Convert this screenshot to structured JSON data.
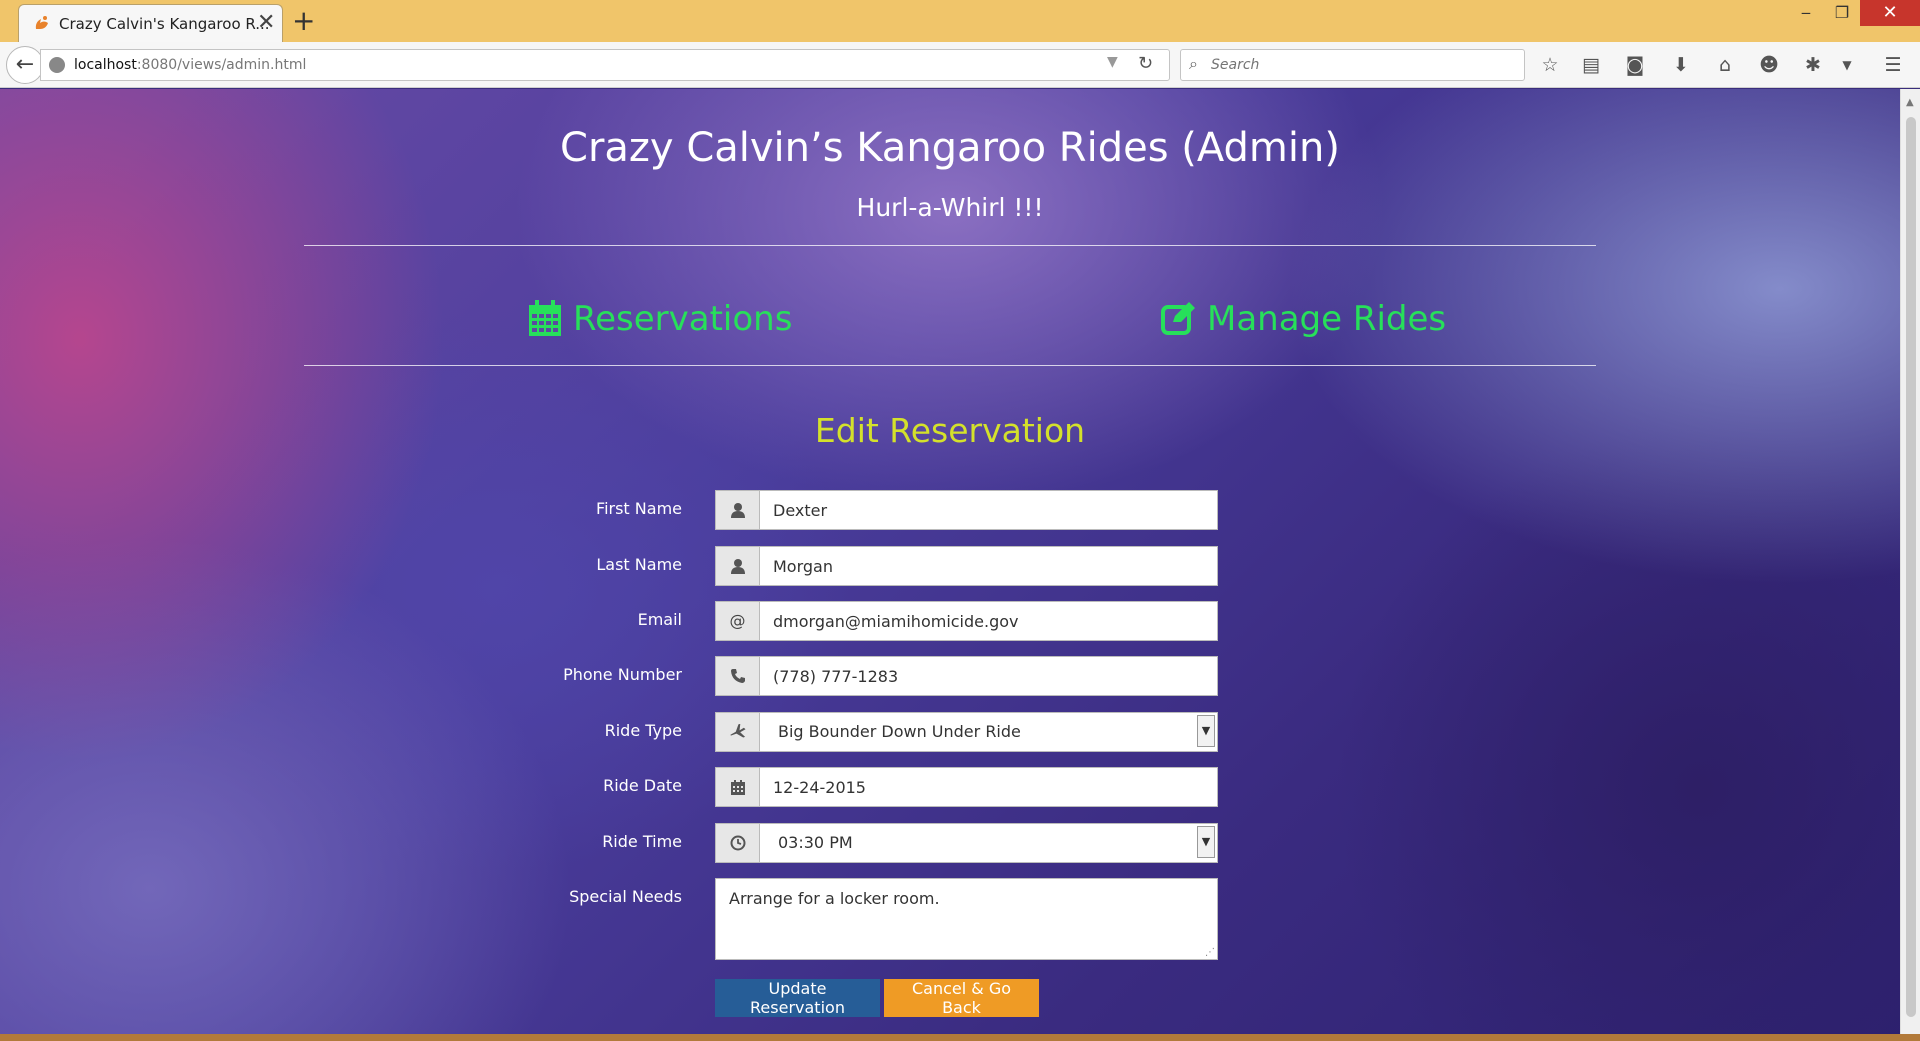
{
  "browser": {
    "tab_title": "Crazy Calvin's Kangaroo R...",
    "tab_close": "✕",
    "new_tab": "+",
    "window_controls": {
      "minimize": "‒",
      "maximize": "❐",
      "close": "✕"
    },
    "url_host": "localhost",
    "url_rest": ":8080/views/admin.html",
    "search_placeholder": "Search",
    "toolbar_icons": [
      "star-icon",
      "reading-list-icon",
      "pocket-icon",
      "download-icon",
      "home-icon",
      "smiley-icon",
      "extension-icon",
      "dropdown-icon",
      "menu-icon"
    ]
  },
  "header": {
    "title": "Crazy Calvin’s Kangaroo Rides (Admin)",
    "subtitle": "Hurl-a-Whirl !!!"
  },
  "nav": {
    "reservations": "Reservations",
    "manage_rides": "Manage Rides"
  },
  "form": {
    "title": "Edit Reservation",
    "first_name": {
      "label": "First Name",
      "value": "Dexter"
    },
    "last_name": {
      "label": "Last Name",
      "value": "Morgan"
    },
    "email": {
      "label": "Email",
      "addon": "@",
      "value": "dmorgan@miamihomicide.gov"
    },
    "phone": {
      "label": "Phone Number",
      "value": "(778) 777-1283"
    },
    "ride_type": {
      "label": "Ride Type",
      "value": "Big Bounder Down Under Ride"
    },
    "ride_date": {
      "label": "Ride Date",
      "value": "12-24-2015"
    },
    "ride_time": {
      "label": "Ride Time",
      "value": "03:30 PM"
    },
    "special_needs": {
      "label": "Special Needs",
      "value": "Arrange for a locker room."
    },
    "update_button": "Update Reservation",
    "cancel_button": "Cancel & Go Back"
  },
  "colors": {
    "nav_link": "#27e05a",
    "form_title": "#d4e12b",
    "update_button": "#265d97",
    "cancel_button": "#ef9b25",
    "tab_bar": "#f0c56a"
  }
}
